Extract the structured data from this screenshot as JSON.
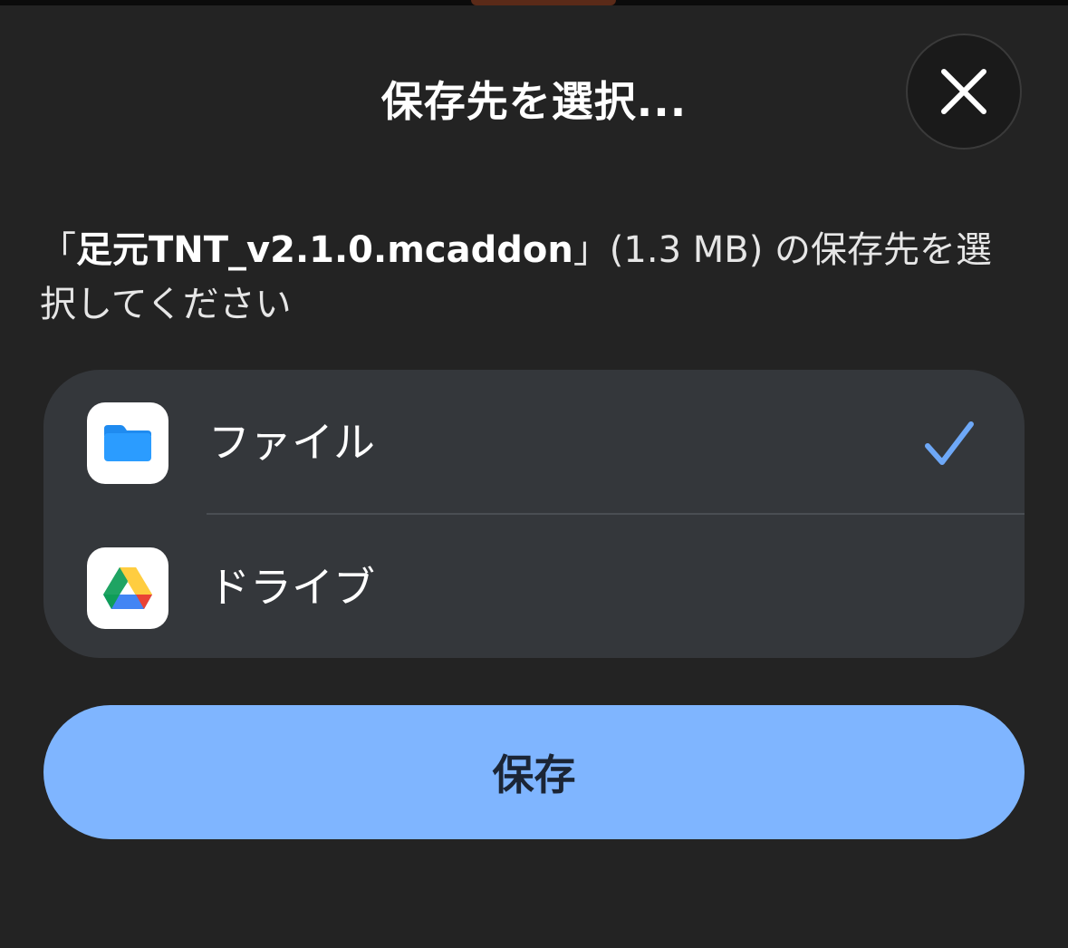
{
  "dialog": {
    "title": "保存先を選択...",
    "description_prefix": "「",
    "filename": "足元TNT_v2.1.0.mcaddon",
    "description_suffix": "」(1.3 MB) の保存先を選択してください"
  },
  "destinations": [
    {
      "label": "ファイル",
      "icon": "files-folder-icon",
      "selected": true
    },
    {
      "label": "ドライブ",
      "icon": "google-drive-icon",
      "selected": false
    }
  ],
  "actions": {
    "save_label": "保存",
    "close_icon": "close-icon"
  },
  "colors": {
    "background": "#232323",
    "list_background": "#34373b",
    "accent": "#7fb5ff",
    "check": "#6ea8f7"
  }
}
